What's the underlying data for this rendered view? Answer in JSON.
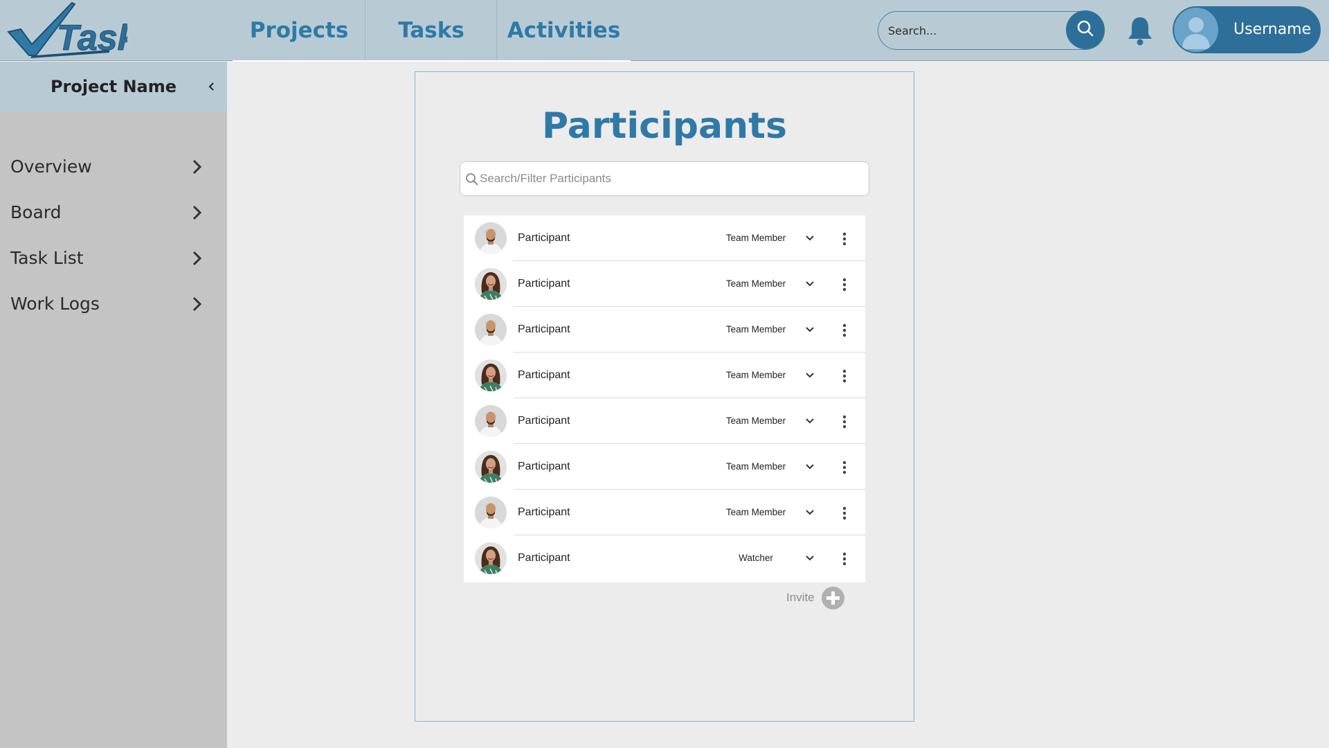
{
  "app": {
    "logo_text": "Tasky"
  },
  "nav": {
    "tabs": [
      {
        "label": "Projects"
      },
      {
        "label": "Tasks"
      },
      {
        "label": "Activities"
      }
    ]
  },
  "search": {
    "placeholder": "Search...",
    "icon": "search-icon"
  },
  "notifications": {
    "icon": "bell-icon"
  },
  "user": {
    "name": "Username",
    "avatar_icon": "user-avatar-icon"
  },
  "sidebar": {
    "project_name": "Project Name",
    "collapse_icon": "chevron-left-icon",
    "items": [
      {
        "label": "Overview"
      },
      {
        "label": "Board"
      },
      {
        "label": "Task List"
      },
      {
        "label": "Work Logs"
      }
    ]
  },
  "main": {
    "title": "Participants",
    "filter_placeholder": "Search/Filter Participants",
    "participants": [
      {
        "name": "Participant",
        "role": "Team Member",
        "avatar": "male-avatar"
      },
      {
        "name": "Participant",
        "role": "Team Member",
        "avatar": "female-avatar"
      },
      {
        "name": "Participant",
        "role": "Team Member",
        "avatar": "male-avatar"
      },
      {
        "name": "Participant",
        "role": "Team Member",
        "avatar": "female-avatar"
      },
      {
        "name": "Participant",
        "role": "Team Member",
        "avatar": "male-avatar"
      },
      {
        "name": "Participant",
        "role": "Team Member",
        "avatar": "female-avatar"
      },
      {
        "name": "Participant",
        "role": "Team Member",
        "avatar": "male-avatar"
      },
      {
        "name": "Participant",
        "role": "Watcher",
        "avatar": "female-avatar"
      }
    ],
    "invite_label": "Invite"
  },
  "colors": {
    "header_bg": "#b8cbd5",
    "accent": "#2f79a6",
    "accent_dark": "#2e6f99",
    "sidebar_bg": "#c4c4c4",
    "page_bg": "#ececec"
  }
}
